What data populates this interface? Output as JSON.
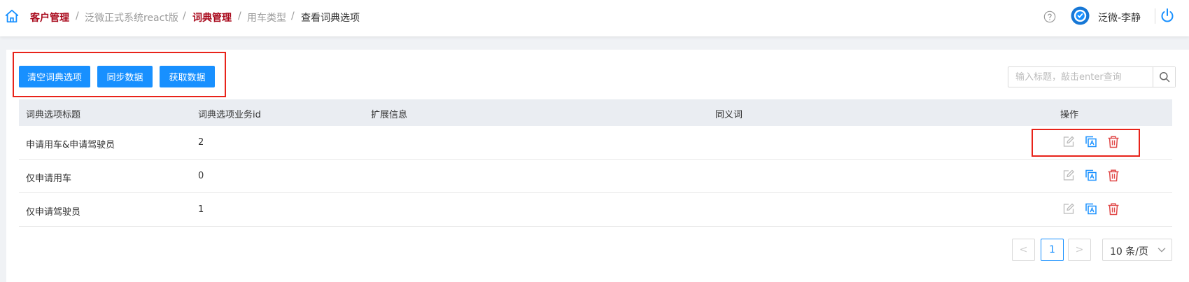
{
  "breadcrumb": {
    "items": [
      "客户管理",
      "泛微正式系统react版",
      "词典管理",
      "用车类型",
      "查看词典选项"
    ],
    "separator": "/"
  },
  "header": {
    "user_name": "泛微-李静"
  },
  "toolbar": {
    "clear_label": "清空词典选项",
    "sync_label": "同步数据",
    "fetch_label": "获取数据"
  },
  "search": {
    "placeholder": "输入标题，敲击enter查询",
    "value": ""
  },
  "table": {
    "columns": [
      "词典选项标题",
      "词典选项业务id",
      "扩展信息",
      "同义词",
      "操作"
    ],
    "rows": [
      {
        "title": "申请用车&申请驾驶员",
        "id": "2",
        "ext": "",
        "synonym": ""
      },
      {
        "title": "仅申请用车",
        "id": "0",
        "ext": "",
        "synonym": ""
      },
      {
        "title": "仅申请驾驶员",
        "id": "1",
        "ext": "",
        "synonym": ""
      }
    ],
    "row_actions": [
      "edit-icon",
      "copy-icon",
      "delete-icon"
    ]
  },
  "pagination": {
    "current_page": "1",
    "prev": "<",
    "next": ">",
    "page_size": "10 条/页"
  },
  "colors": {
    "primary": "#1890ff",
    "breadcrumb_active": "#a8071a",
    "annotation_box": "#e8231a",
    "delete": "#e04848"
  }
}
